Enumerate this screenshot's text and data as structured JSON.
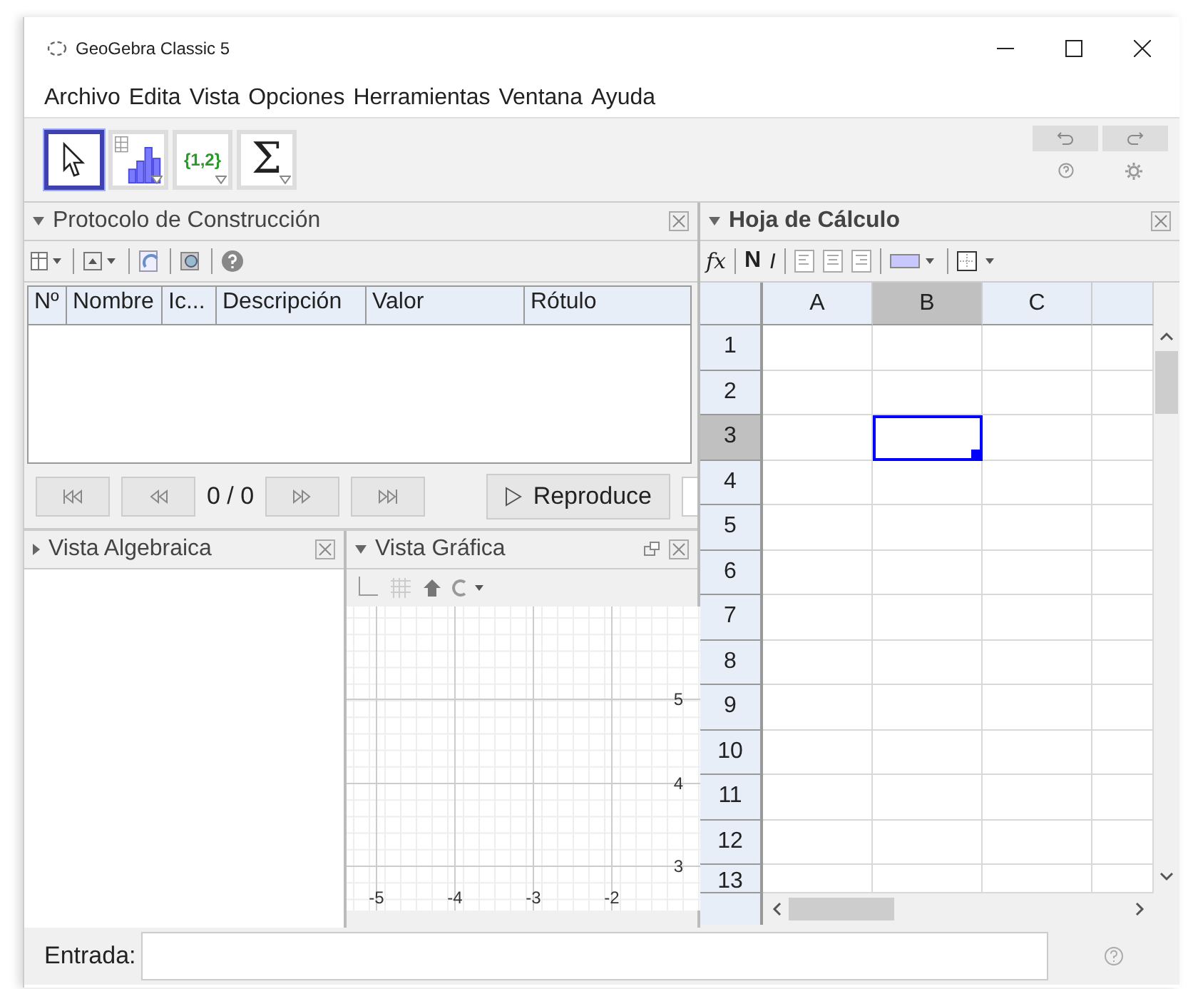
{
  "window": {
    "title": "GeoGebra Classic 5"
  },
  "menu": [
    "Archivo",
    "Edita",
    "Vista",
    "Opciones",
    "Herramientas",
    "Ventana",
    "Ayuda"
  ],
  "tools": [
    {
      "kind": "move",
      "selected": true
    },
    {
      "kind": "chart",
      "selected": false
    },
    {
      "kind": "list",
      "label": "{1,2}",
      "selected": false
    },
    {
      "kind": "sum",
      "label": "Σ",
      "selected": false
    }
  ],
  "protocol": {
    "title": "Protocolo de Construcción",
    "columns": [
      "Nº",
      "Nombre",
      "Ic...",
      "Descripción",
      "Valor",
      "Rótulo"
    ],
    "counter": "0 / 0",
    "play_button": "Reproduce"
  },
  "algebra": {
    "title": "Vista Algebraica"
  },
  "graphics": {
    "title": "Vista Gráfica",
    "x_labels": [
      "-5",
      "-4",
      "-3",
      "-2"
    ],
    "y_labels": [
      "5",
      "4",
      "3"
    ]
  },
  "spreadsheet": {
    "title": "Hoja de Cálculo",
    "toolbar": {
      "fx": "fx",
      "bold": "N",
      "italic": "I"
    },
    "columns": [
      {
        "label": "A",
        "selected": false
      },
      {
        "label": "B",
        "selected": true
      },
      {
        "label": "C",
        "selected": false
      }
    ],
    "rows": [
      {
        "label": "1",
        "selected": false
      },
      {
        "label": "2",
        "selected": false
      },
      {
        "label": "3",
        "selected": true
      },
      {
        "label": "4",
        "selected": false
      },
      {
        "label": "5",
        "selected": false
      },
      {
        "label": "6",
        "selected": false
      },
      {
        "label": "7",
        "selected": false
      },
      {
        "label": "8",
        "selected": false
      },
      {
        "label": "9",
        "selected": false
      },
      {
        "label": "10",
        "selected": false
      },
      {
        "label": "11",
        "selected": false
      },
      {
        "label": "12",
        "selected": false
      },
      {
        "label": "13",
        "selected": false
      }
    ]
  },
  "input_bar": {
    "label": "Entrada:"
  }
}
